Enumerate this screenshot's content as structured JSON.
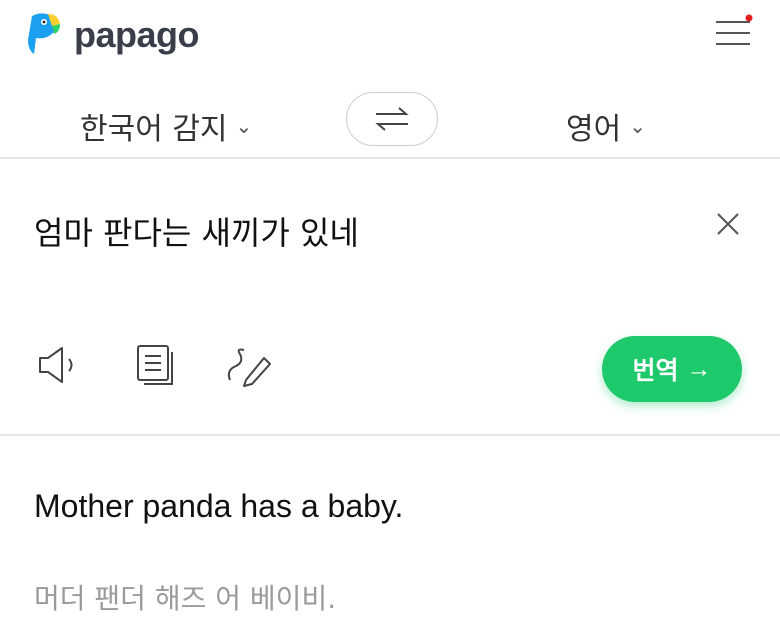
{
  "header": {
    "brand": "papago",
    "menu_icon": "hamburger-icon",
    "notification_dot_color": "#e02020"
  },
  "languages": {
    "source": "한국어 감지",
    "target": "영어",
    "swap_icon": "swap-arrows-icon"
  },
  "input": {
    "text": "엄마 판다는 새끼가 있네",
    "clear_icon": "close-icon"
  },
  "tools": {
    "speak_icon": "speaker-icon",
    "copy_icon": "copy-icon",
    "handwriting_icon": "handwriting-icon"
  },
  "translate_button": {
    "label": "번역",
    "arrow": "→",
    "color": "#1ec96b"
  },
  "output": {
    "translation": "Mother panda has a baby.",
    "pronunciation": "머더 팬더 해즈 어 베이비."
  }
}
